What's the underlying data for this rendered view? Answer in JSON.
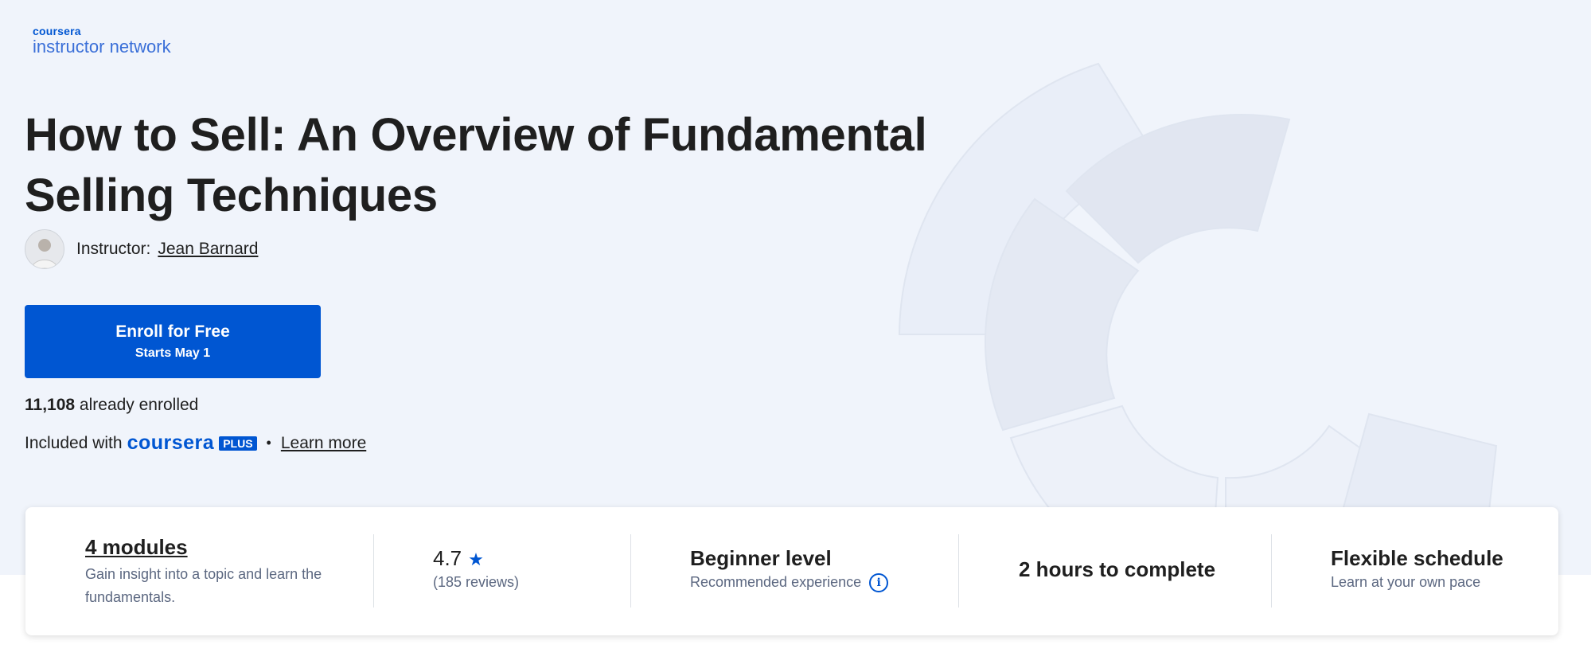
{
  "brand": {
    "top": "coursera",
    "bottom": "instructor network"
  },
  "course": {
    "title": "How to Sell: An Overview of Fundamental Selling Techniques",
    "instructor_label": "Instructor:",
    "instructor_name": "Jean Barnard"
  },
  "enroll": {
    "label": "Enroll for Free",
    "sub": "Starts May 1"
  },
  "enrolled": {
    "count": "11,108",
    "text": "already enrolled"
  },
  "included": {
    "prefix": "Included with",
    "plus_word": "coursera",
    "plus_badge": "PLUS",
    "separator": "•",
    "learn_more": "Learn more"
  },
  "stats": {
    "modules": {
      "title": "4 modules",
      "desc": "Gain insight into a topic and learn the fundamentals."
    },
    "rating": {
      "value": "4.7",
      "reviews": "(185 reviews)"
    },
    "level": {
      "title": "Beginner level",
      "desc": "Recommended experience"
    },
    "duration": {
      "title": "2 hours to complete"
    },
    "schedule": {
      "title": "Flexible schedule",
      "desc": "Learn at your own pace"
    }
  },
  "colors": {
    "accent": "#0056d2",
    "hero_bg": "#f0f4fb"
  },
  "icons": {
    "star": "star-icon",
    "info": "info-icon"
  }
}
